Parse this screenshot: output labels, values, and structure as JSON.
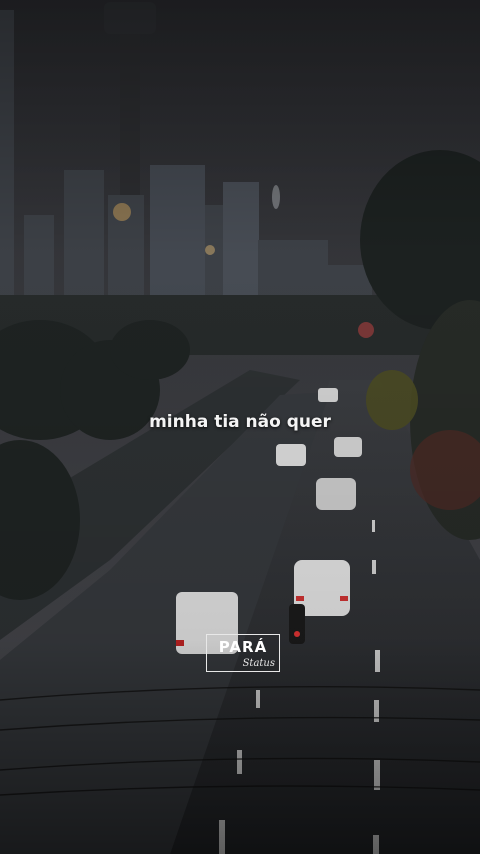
{
  "caption": "minha tia não quer",
  "watermark": {
    "main": "PARÁ",
    "sub": "Status"
  }
}
